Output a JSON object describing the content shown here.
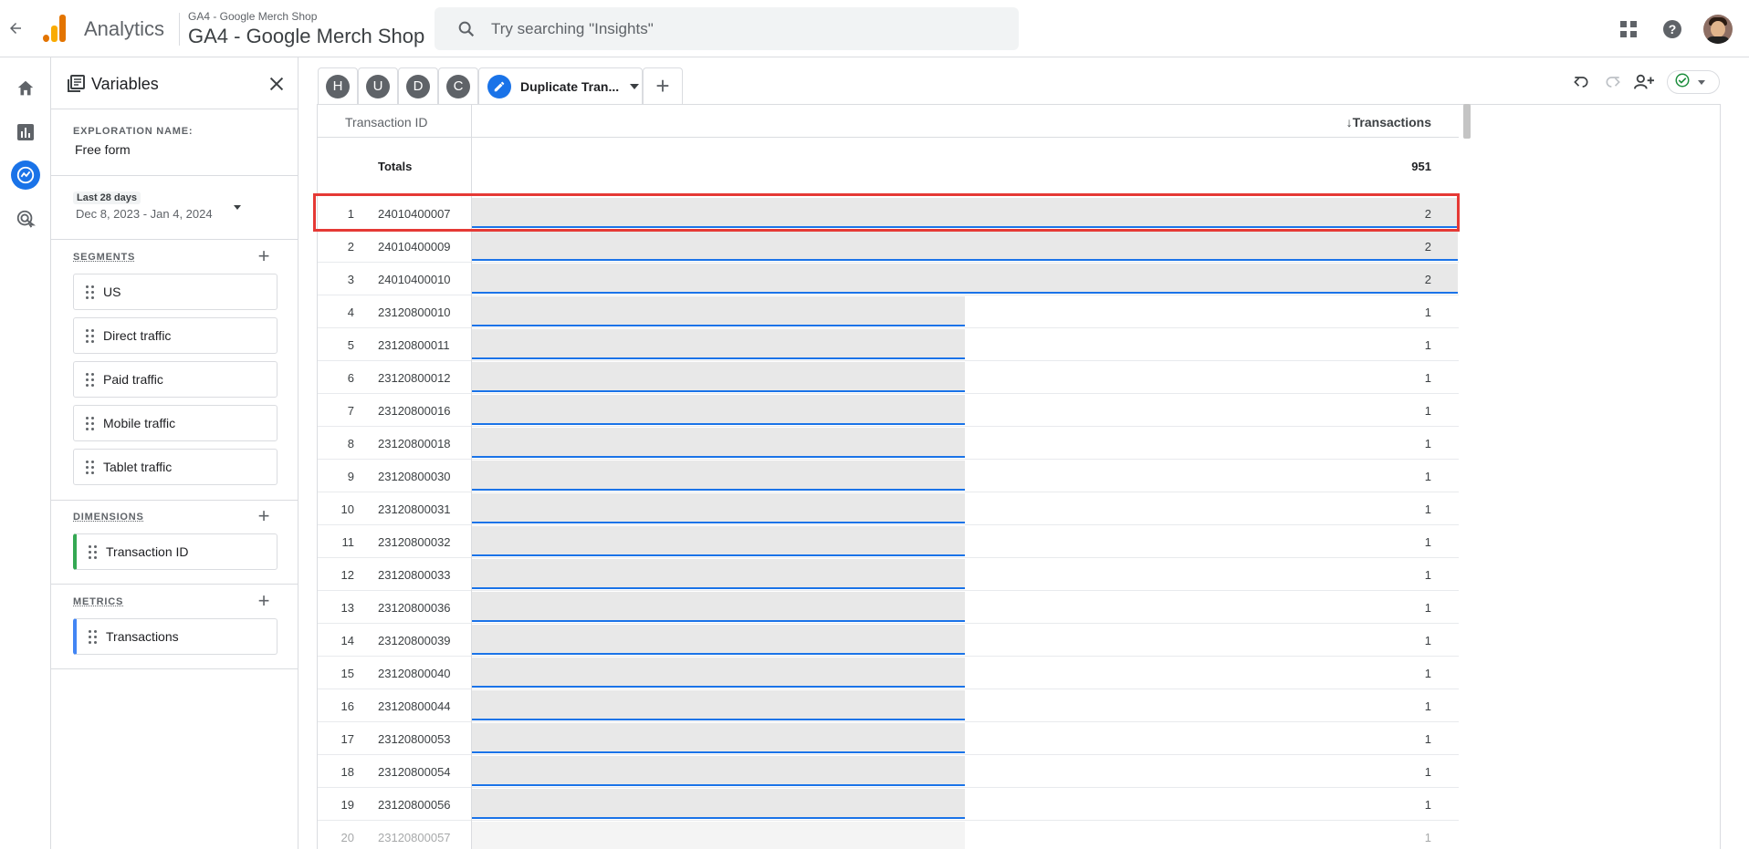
{
  "topbar": {
    "app_name": "Analytics",
    "account_small": "GA4 - Google Merch Shop",
    "account_big": "GA4 - Google Merch Shop",
    "search_placeholder": "Try searching \"Insights\""
  },
  "variables": {
    "title": "Variables",
    "exploration_label": "EXPLORATION NAME:",
    "exploration_name": "Free form",
    "date_badge": "Last 28 days",
    "date_range": "Dec 8, 2023 - Jan 4, 2024",
    "segments_label": "SEGMENTS",
    "segments": [
      "US",
      "Direct traffic",
      "Paid traffic",
      "Mobile traffic",
      "Tablet traffic"
    ],
    "dimensions_label": "DIMENSIONS",
    "dimensions": [
      "Transaction ID"
    ],
    "metrics_label": "METRICS",
    "metrics": [
      "Transactions"
    ]
  },
  "tabs": {
    "letters": [
      "H",
      "U",
      "D",
      "C"
    ],
    "active": "Duplicate Tran..."
  },
  "table": {
    "col_dimension": "Transaction ID",
    "col_metric": "↓Transactions",
    "totals_label": "Totals",
    "totals_value": "951",
    "max_value": 2,
    "rows": [
      {
        "idx": "1",
        "id": "24010400007",
        "value": 2
      },
      {
        "idx": "2",
        "id": "24010400009",
        "value": 2
      },
      {
        "idx": "3",
        "id": "24010400010",
        "value": 2
      },
      {
        "idx": "4",
        "id": "23120800010",
        "value": 1
      },
      {
        "idx": "5",
        "id": "23120800011",
        "value": 1
      },
      {
        "idx": "6",
        "id": "23120800012",
        "value": 1
      },
      {
        "idx": "7",
        "id": "23120800016",
        "value": 1
      },
      {
        "idx": "8",
        "id": "23120800018",
        "value": 1
      },
      {
        "idx": "9",
        "id": "23120800030",
        "value": 1
      },
      {
        "idx": "10",
        "id": "23120800031",
        "value": 1
      },
      {
        "idx": "11",
        "id": "23120800032",
        "value": 1
      },
      {
        "idx": "12",
        "id": "23120800033",
        "value": 1
      },
      {
        "idx": "13",
        "id": "23120800036",
        "value": 1
      },
      {
        "idx": "14",
        "id": "23120800039",
        "value": 1
      },
      {
        "idx": "15",
        "id": "23120800040",
        "value": 1
      },
      {
        "idx": "16",
        "id": "23120800044",
        "value": 1
      },
      {
        "idx": "17",
        "id": "23120800053",
        "value": 1
      },
      {
        "idx": "18",
        "id": "23120800054",
        "value": 1
      },
      {
        "idx": "19",
        "id": "23120800056",
        "value": 1
      },
      {
        "idx": "20",
        "id": "23120800057",
        "value": 1
      }
    ]
  },
  "colors": {
    "accent": "#1a73e8",
    "highlight": "#e53935",
    "dimension": "#34a853",
    "metric": "#4285f4"
  },
  "icons": [
    "back-arrow-icon",
    "analytics-logo-icon",
    "search-icon",
    "apps-grid-icon",
    "help-icon",
    "home-icon",
    "reports-icon",
    "explore-icon",
    "advertising-icon",
    "variables-icon",
    "close-icon",
    "pencil-icon",
    "undo-icon",
    "redo-icon",
    "share-icon",
    "check-circle-icon"
  ]
}
